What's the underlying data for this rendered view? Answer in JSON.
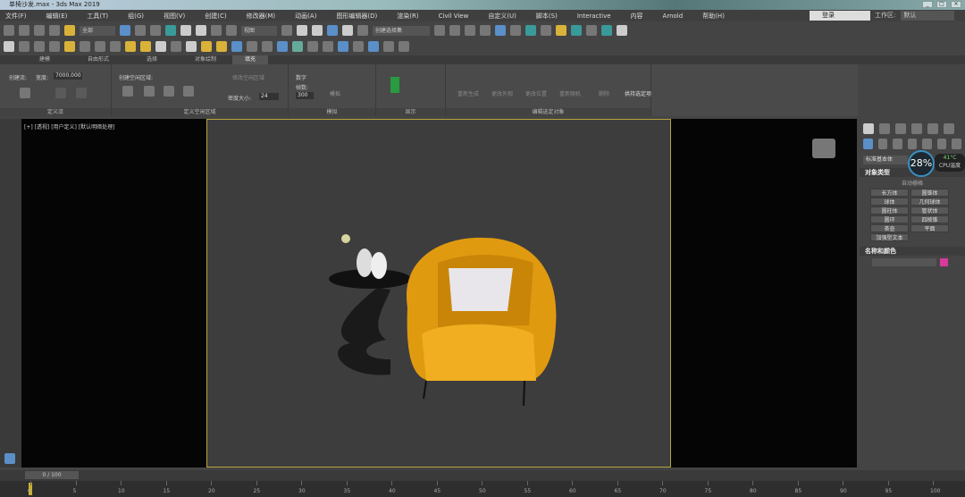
{
  "title": "单椅沙发.max - 3ds Max 2019",
  "menu": [
    "文件(F)",
    "编辑(E)",
    "工具(T)",
    "组(G)",
    "视图(V)",
    "创建(C)",
    "修改器(M)",
    "动画(A)",
    "图形编辑器(D)",
    "渲染(R)",
    "Civil View",
    "自定义(U)",
    "脚本(S)",
    "Interactive",
    "内容",
    "Arnold",
    "帮助(H)"
  ],
  "login": "登录",
  "workspace_label": "工作区:",
  "workspace_value": "默认",
  "toolbar": {
    "filter": "全部",
    "ref_coord": "视图",
    "selset": "创建选择集"
  },
  "ribbon_tabs": [
    "建模",
    "自由形式",
    "选择",
    "对象绘制",
    "填充"
  ],
  "ribbon": {
    "flow": {
      "title": "定义流",
      "create_flow": "创建流:",
      "width_label": "宽度:",
      "width_value": "7000.000"
    },
    "idle": {
      "title": "定义空闲区域",
      "create_idle": "创建空闲区域:",
      "dense": "密度大小:",
      "dense_value": "24",
      "edit": "修改空闲区域"
    },
    "sim": {
      "title": "模拟",
      "count": "数字",
      "frames": "帧数:",
      "frames_value": "300",
      "sim": "模拟"
    },
    "display": {
      "title": "显示"
    },
    "edit": {
      "title": "编辑选定对象",
      "items": [
        "重新生成",
        "更改外观",
        "更改位置",
        "重新随机",
        "删除",
        "拱持选定项"
      ]
    }
  },
  "viewport_label": "[+] [透视] [用户定义] [默认明暗处理]",
  "cmd": {
    "category": "标准基本体",
    "obj_type": "对象类型",
    "autogrid": "自动栅格",
    "buttons": [
      "长方体",
      "圆锥体",
      "球体",
      "几何球体",
      "圆柱体",
      "管状体",
      "圆环",
      "四棱锥",
      "茶壶",
      "平面",
      "加强型文本"
    ],
    "name_color": "名称和颜色",
    "color": "#d63a9a"
  },
  "cpu": {
    "percent": "28%",
    "temp": "41°C",
    "temp_label": "CPU温度"
  },
  "time": {
    "slider": "0 / 100",
    "ticks": [
      "0",
      "5",
      "10",
      "15",
      "20",
      "25",
      "30",
      "35",
      "40",
      "45",
      "50",
      "55",
      "60",
      "65",
      "70",
      "75",
      "80",
      "85",
      "90",
      "95",
      "100"
    ]
  }
}
